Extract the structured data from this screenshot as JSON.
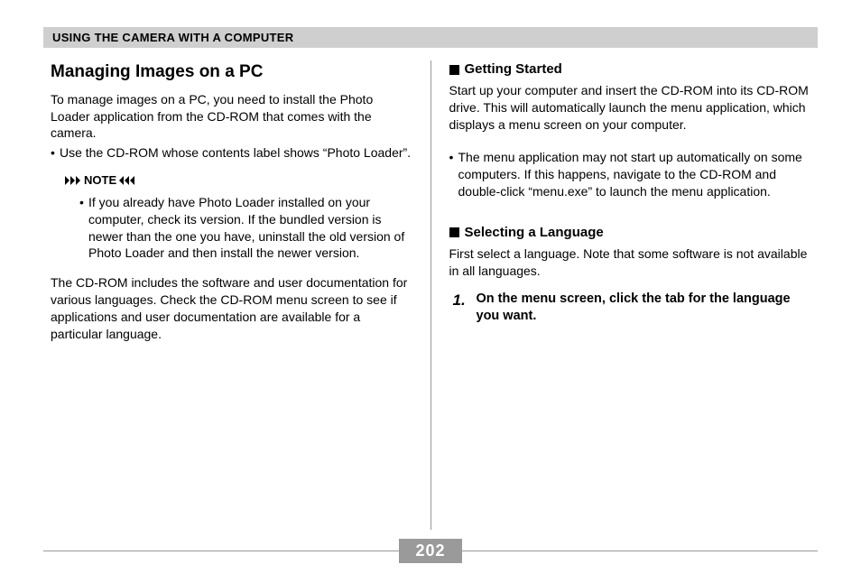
{
  "header": "USING THE CAMERA WITH A COMPUTER",
  "pageNumber": "202",
  "left": {
    "title": "Managing Images on a PC",
    "intro": "To manage images on a PC, you need to install the Photo Loader application from the CD-ROM that comes with the camera.",
    "bullet": "Use the CD-ROM whose contents label shows “Photo Loader”.",
    "noteLabel": "NOTE",
    "noteBody": "If you already have Photo Loader installed on your computer, check its version. If the bundled version is newer than the one you have, uninstall the old version of Photo Loader and then install the newer version.",
    "para2": "The CD-ROM includes the software and user documentation for various languages. Check the CD-ROM menu screen to see if applications and user documentation are available for a particular language."
  },
  "right": {
    "h1": "Getting Started",
    "p1": "Start up your computer and insert the CD-ROM into its CD-ROM drive. This will automatically launch the menu application, which displays a menu screen on your computer.",
    "bullet": "The menu application may not start up automatically on some computers. If this happens, navigate to the CD-ROM and double-click “menu.exe” to launch the menu application.",
    "h2": "Selecting a Language",
    "p2": "First select a language. Note that some software is not available in all languages.",
    "stepNum": "1.",
    "stepText": "On the menu screen, click the tab for the language you want."
  }
}
